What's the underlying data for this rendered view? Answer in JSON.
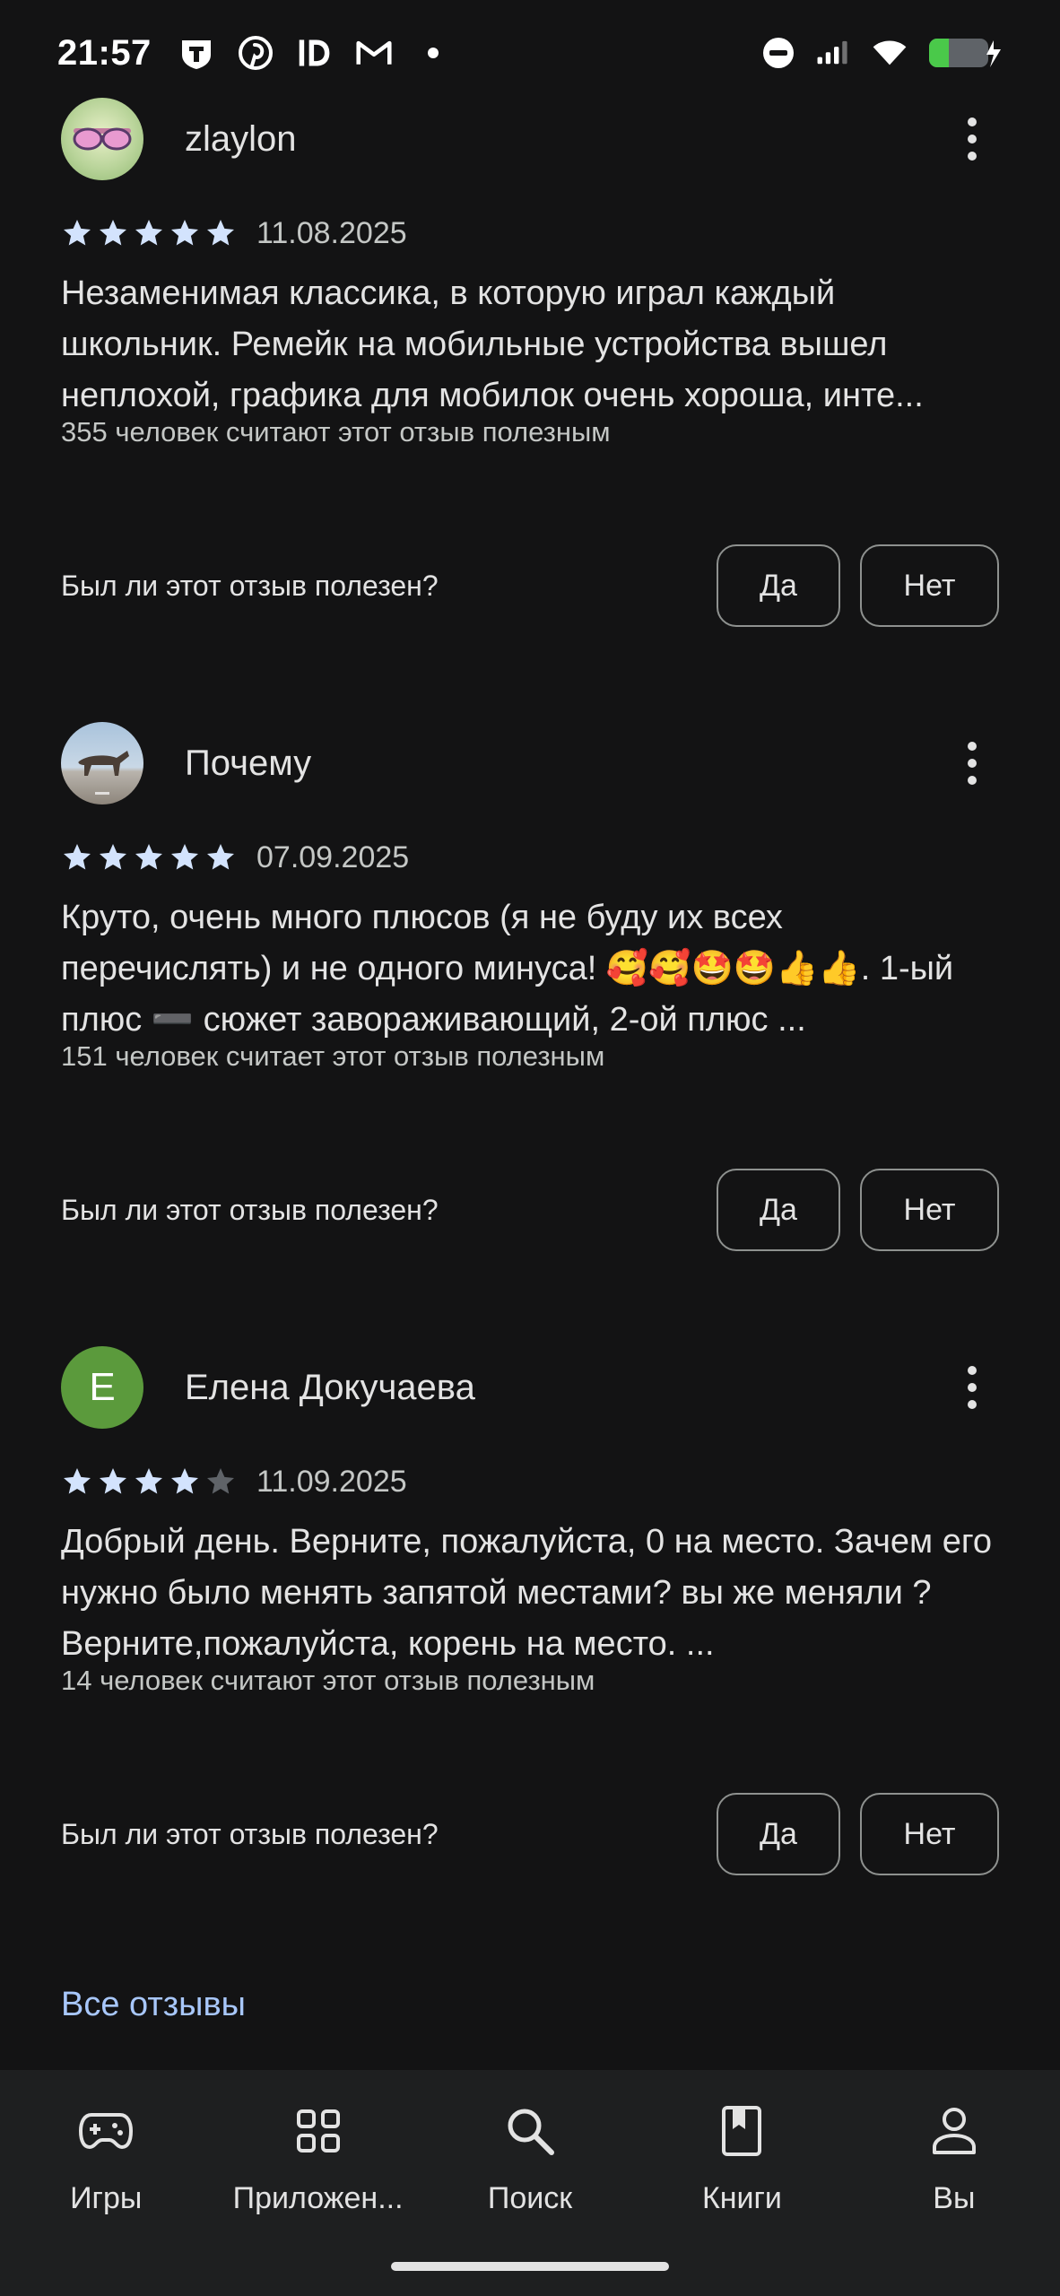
{
  "status_bar": {
    "time": "21:57",
    "left_icons": [
      "t-shield-icon",
      "pinterest-icon",
      "id-icon",
      "gmail-icon",
      "notification-dot-icon"
    ],
    "right_icons": [
      "do-not-disturb-icon",
      "signal-icon",
      "wifi-icon",
      "battery-charging-icon"
    ]
  },
  "reviews": [
    {
      "reviewer": "zlaylon",
      "avatar": "sunglasses-avatar",
      "rating": 5,
      "date": "11.08.2025",
      "text": "Незаменимая классика, в которую играл каждый школьник. Ремейк на мобильные устройства вышел неплохой, графика для мобилок очень хороша, инте...",
      "helpful_count": "355 человек считают этот отзыв полезным",
      "question": "Был ли этот отзыв полезен?",
      "yes": "Да",
      "no": "Нет"
    },
    {
      "reviewer": "Почему",
      "avatar": "horse-photo-avatar",
      "rating": 5,
      "date": "07.09.2025",
      "text": "Круто, очень много плюсов (я не буду их всех перечислять) и не одного минуса! 🥰🥰🤩🤩👍👍. 1-ый плюс ➖ сюжет завораживающий, 2-ой плюс ...",
      "helpful_count": "151 человек считает этот отзыв полезным",
      "question": "Был ли этот отзыв полезен?",
      "yes": "Да",
      "no": "Нет"
    },
    {
      "reviewer": "Елена Докучаева",
      "avatar": "letter-avatar",
      "avatar_letter": "Е",
      "avatar_color": "#5b9a3c",
      "rating": 4,
      "date": "11.09.2025",
      "text": "Добрый день. Верните, пожалуйста, 0 на место. Зачем его нужно было менять запятой местами? вы же меняли ?Верните,пожалуйста, корень на место. ...",
      "helpful_count": "14 человек считают этот отзыв полезным",
      "question": "Был ли этот отзыв полезен?",
      "yes": "Да",
      "no": "Нет"
    }
  ],
  "all_reviews_link": "Все отзывы",
  "nav": [
    {
      "label": "Игры",
      "icon": "gamepad-icon"
    },
    {
      "label": "Приложен...",
      "icon": "apps-grid-icon"
    },
    {
      "label": "Поиск",
      "icon": "search-icon"
    },
    {
      "label": "Книги",
      "icon": "book-icon"
    },
    {
      "label": "Вы",
      "icon": "person-icon"
    }
  ],
  "colors": {
    "background": "#131314",
    "nav_background": "#1e1f20",
    "star_filled": "#d3e3fd",
    "star_empty": "#5f6368",
    "link": "#a8c7fa"
  }
}
